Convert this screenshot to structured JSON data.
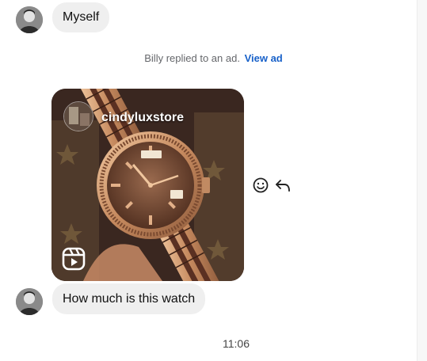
{
  "messages": {
    "first_text": "Myself",
    "reply_note": "Billy replied to an ad.",
    "view_ad_link": "View ad",
    "ad": {
      "handle": "cindyluxstore"
    },
    "second_text": "How much is this watch",
    "timestamp": "11:06"
  },
  "icons": {
    "react": "smiley-icon",
    "reply": "reply-arrow-icon",
    "reel": "reels-icon"
  },
  "colors": {
    "bubble_bg": "#efefef",
    "link": "#1861c9",
    "muted_text": "#65676b"
  }
}
